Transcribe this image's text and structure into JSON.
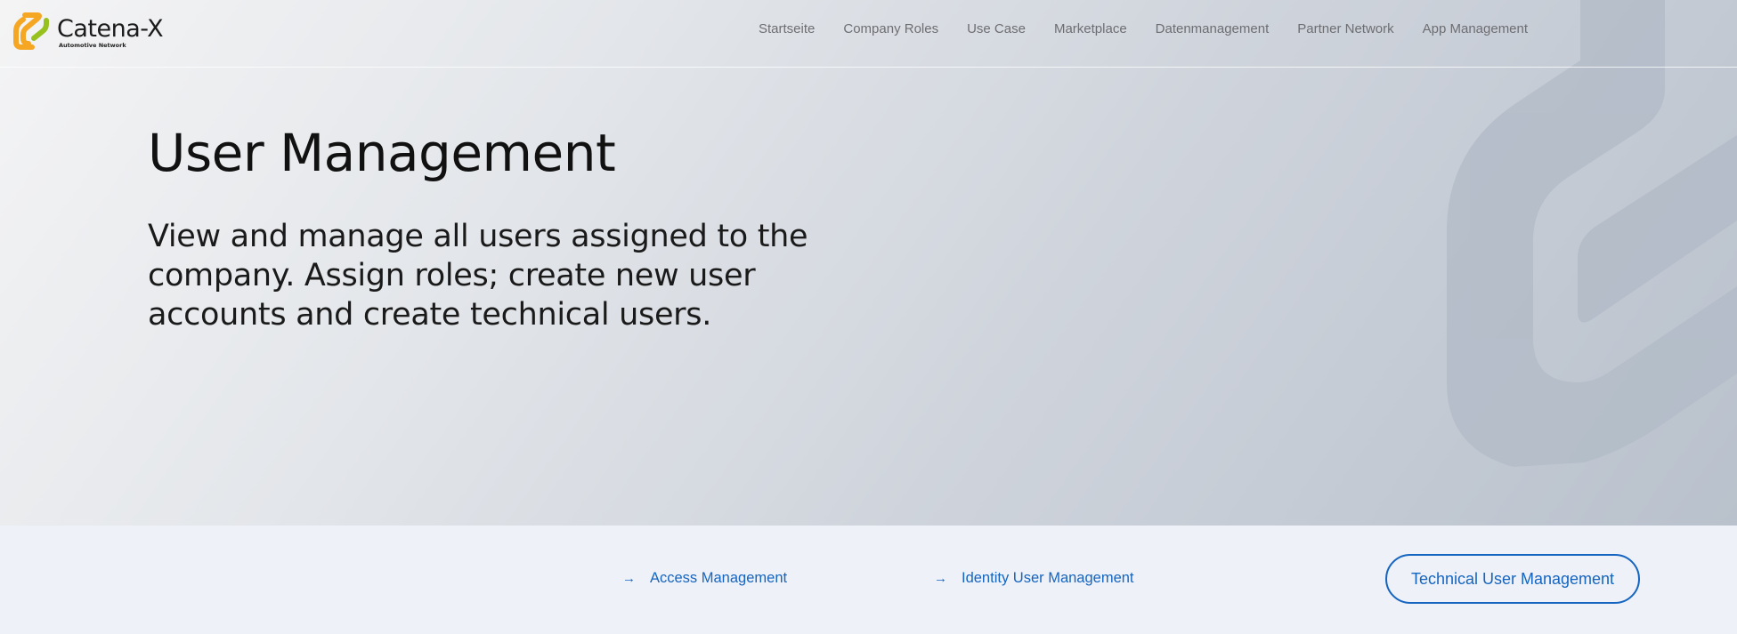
{
  "brand": {
    "name": "Catena-X",
    "tagline": "Automotive Network",
    "colors": {
      "logo_orange": "#f5a623",
      "logo_green": "#97c11f"
    }
  },
  "nav": {
    "items": [
      {
        "label": "Startseite"
      },
      {
        "label": "Company Roles"
      },
      {
        "label": "Use Case"
      },
      {
        "label": "Marketplace"
      },
      {
        "label": "Datenmanagement"
      },
      {
        "label": "Partner Network"
      },
      {
        "label": "App Management"
      }
    ]
  },
  "hero": {
    "title": "User Management",
    "description": "View and manage all users assigned to the company. Assign roles; create new user accounts and create technical users."
  },
  "subnav": {
    "links": [
      {
        "label": "Access Management",
        "icon": "arrow-right-icon"
      },
      {
        "label": "Identity User Management",
        "icon": "arrow-right-icon"
      }
    ],
    "button_label": "Technical User Management",
    "accent_color": "#1565c0"
  }
}
